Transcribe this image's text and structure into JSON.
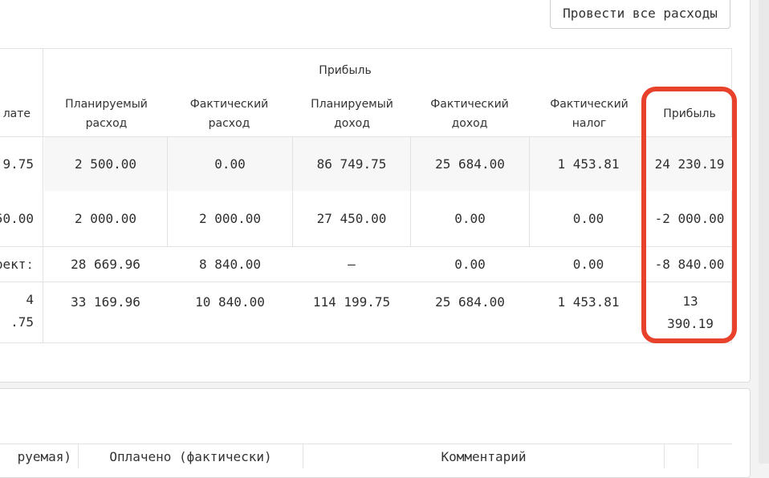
{
  "toolbar": {
    "post_all_label": "Провести все расходы"
  },
  "profit_table": {
    "group_header": "Прибыль",
    "left_header_fragment": "лате",
    "columns": [
      "Планируемый расход",
      "Фактический расход",
      "Планируемый доход",
      "Фактический доход",
      "Фактический налог",
      "Прибыль"
    ],
    "rows": [
      {
        "left": "9.75",
        "values": [
          "2 500.00",
          "0.00",
          "86 749.75",
          "25 684.00",
          "1 453.81",
          "24 230.19"
        ]
      },
      {
        "left": "50.00",
        "values": [
          "2 000.00",
          "2 000.00",
          "27 450.00",
          "0.00",
          "0.00",
          "-2 000.00"
        ]
      },
      {
        "left": "ректː",
        "values": [
          "28 669.96",
          "8 840.00",
          "–",
          "0.00",
          "0.00",
          "-8 840.00"
        ]
      },
      {
        "left": "4\n.75",
        "values": [
          "33 169.96",
          "10 840.00",
          "114 199.75",
          "25 684.00",
          "1 453.81",
          "13 390.19"
        ]
      }
    ]
  },
  "bottom_table": {
    "headers": [
      "руемая)",
      "Оплачено (фактически)",
      "Комментарий"
    ]
  },
  "colors": {
    "highlight": "#e8412c"
  }
}
